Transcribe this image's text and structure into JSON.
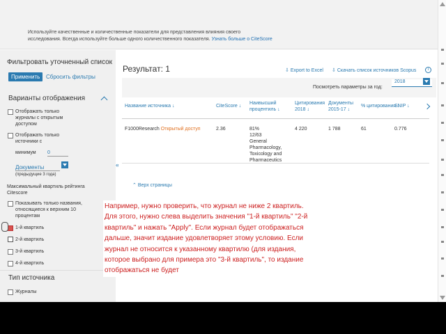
{
  "banner": {
    "line1": "Используйте качественные и количественные показатели для представления влияния своего",
    "line2": "исследования. Всегда используйте больше одного количественного показателя.",
    "link": "Узнать больше о CiteScore"
  },
  "sidebar": {
    "filter_title": "Фильтровать уточненный список",
    "apply_label": "Применить",
    "reset_label": "Сбросить фильтры",
    "display_section_title": "Варианты отображения",
    "option_open_access": "Отображать только журналы с открытым доступом",
    "option_min_sources": "Отображать только источники с",
    "min_label": "минимум",
    "min_value": "0",
    "documents_select": "Документы",
    "documents_hint": "(предыдущие 3 года)",
    "quartile_title": "Максимальный квартиль рейтинга Citescore",
    "option_top_percent": "Показывать только названия, относящиеся к верхним 10 процентам",
    "quartiles": [
      "1-й квартиль",
      "2-й квартиль",
      "3-й квартиль",
      "4-й квартиль"
    ],
    "source_type_title": "Тип источника",
    "source_journals": "Журналы"
  },
  "main": {
    "result_label": "Результат: 1",
    "export_excel": "Export to Excel",
    "download_list": "Скачать список источников Scopus",
    "params_label": "Посмотреть параметры за год:",
    "year_value": "2018",
    "columns": [
      "Название источника",
      "CiteScore",
      "Наивысший процентиль",
      "Цитирования 2018",
      "Документы 2015-17",
      "% цитирования",
      "SNIP"
    ],
    "row": {
      "name": "F1000Research",
      "open_access": "Открытый доступ",
      "citescore": "2.36",
      "percentile": "81%",
      "rank": "12/63",
      "field1": "General",
      "field2": "Pharmacology,",
      "field3": "Toxicology and",
      "field4": "Pharmaceutics",
      "citations": "4 220",
      "documents": "1 788",
      "pct_cited": "61",
      "snip": "0.776"
    },
    "back_top": "Верх страницы"
  },
  "note": {
    "text": "Например, нужно проверить, что журнал не ниже 2 квартиль. Для этого, нужно слева выделить значения \"1-й квартиль\" \"2-й квартиль\" и нажать \"Apply\". Если журнал будет отображаться дальше, значит издание удовлетворяет этому условию. Если журнал не относится к указанному квартилю (для издания, которое выбрано для примера это \"3-й квартиль\", то издание отображаться не будет"
  },
  "icons": {
    "collapse": "double-chevron-left-icon",
    "export": "download-icon",
    "info": "info-icon",
    "next": "chevron-right-icon"
  },
  "colors": {
    "accent": "#2a7ab0",
    "open_access": "#e07020",
    "note_text": "#cc1f1f"
  }
}
